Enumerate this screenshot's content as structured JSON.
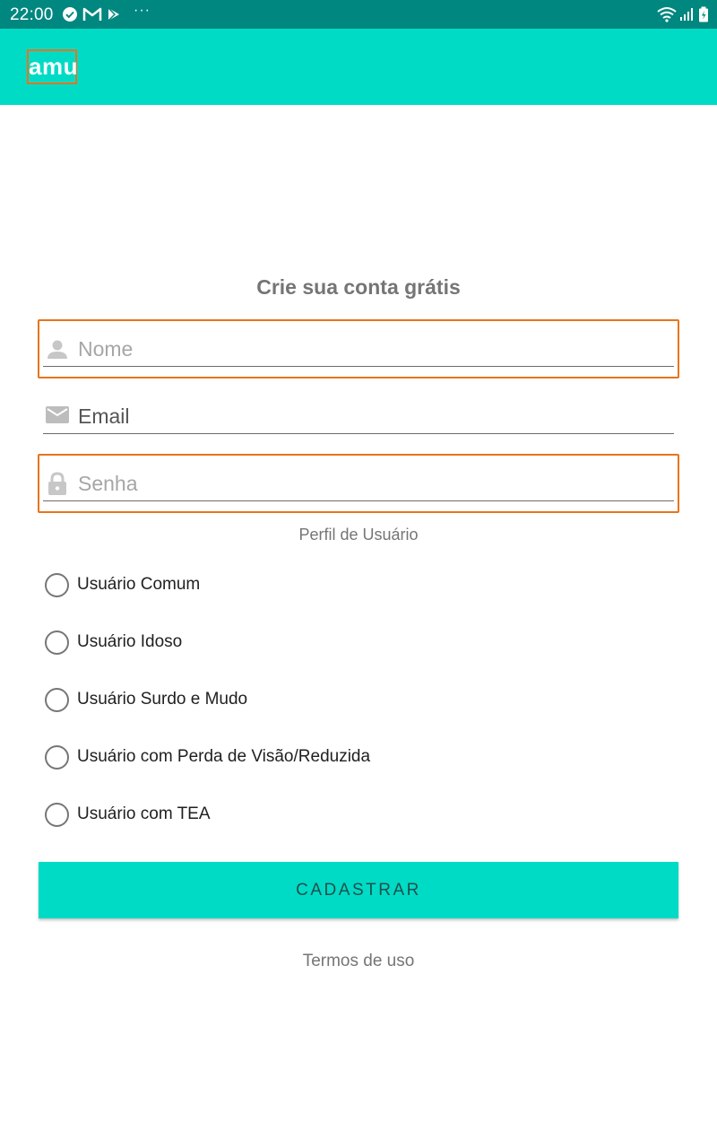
{
  "status_bar": {
    "time": "22:00",
    "more_indicator": "···",
    "icons_left": [
      "check-circle-icon",
      "gmail-icon",
      "play-store-icon"
    ],
    "icons_right": [
      "wifi-icon",
      "cell-signal-icon",
      "battery-icon"
    ]
  },
  "app_bar": {
    "logo_text": "amu",
    "background_color": "#00dbc6"
  },
  "form": {
    "title": "Crie sua conta grátis",
    "fields": {
      "name": {
        "placeholder": "Nome",
        "icon": "person-icon"
      },
      "email": {
        "value": "Email",
        "icon": "mail-icon"
      },
      "password": {
        "placeholder": "Senha",
        "icon": "lock-icon"
      }
    },
    "profile_label": "Perfil de Usuário",
    "profile_options": [
      "Usuário Comum",
      "Usuário Idoso",
      "Usuário Surdo e Mudo",
      "Usuário com Perda de Visão/Reduzida",
      "Usuário com TEA"
    ],
    "submit_label": "CADASTRAR",
    "terms_label": "Termos de uso"
  },
  "colors": {
    "status_bar": "#00877f",
    "accent": "#00dbc6",
    "highlight_border": "#e8741c"
  }
}
